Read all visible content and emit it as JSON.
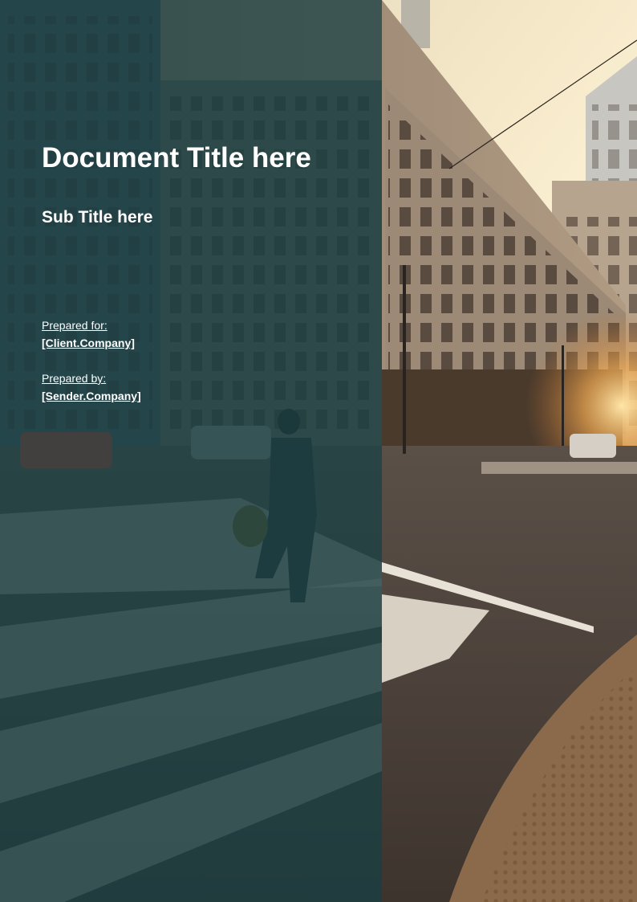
{
  "cover": {
    "title": "Document Title here",
    "subtitle": "Sub Title here",
    "prepared_for_label": "Prepared for:",
    "prepared_for_value": "[Client.Company]",
    "prepared_by_label": "Prepared by:",
    "prepared_by_value": "[Sender.Company]"
  },
  "colors": {
    "overlay": "#164044",
    "text": "#ffffff"
  }
}
